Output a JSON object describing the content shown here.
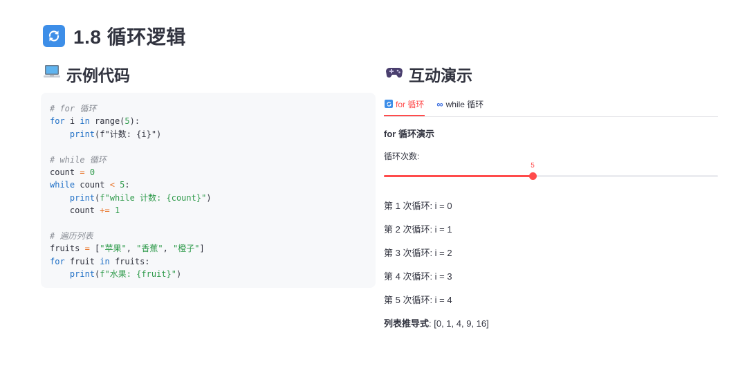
{
  "header": {
    "title": "1.8 循环逻辑",
    "icon": "arrows-cycle-icon"
  },
  "left": {
    "heading": "示例代码",
    "heading_icon": "laptop-icon",
    "code_lines": [
      [
        {
          "t": "# for 循环",
          "c": "cmt"
        }
      ],
      [
        {
          "t": "for",
          "c": "kw"
        },
        {
          "t": " i ",
          "c": "plain"
        },
        {
          "t": "in",
          "c": "kw"
        },
        {
          "t": " range(",
          "c": "plain"
        },
        {
          "t": "5",
          "c": "num"
        },
        {
          "t": "):",
          "c": "plain"
        }
      ],
      [
        {
          "t": "    ",
          "c": "plain"
        },
        {
          "t": "print",
          "c": "fn"
        },
        {
          "t": "(f\"计数: {i}\")",
          "c": "plain"
        }
      ],
      [],
      [
        {
          "t": "# while 循环",
          "c": "cmt"
        }
      ],
      [
        {
          "t": "count ",
          "c": "plain"
        },
        {
          "t": "=",
          "c": "op"
        },
        {
          "t": " ",
          "c": "plain"
        },
        {
          "t": "0",
          "c": "num"
        }
      ],
      [
        {
          "t": "while",
          "c": "kw"
        },
        {
          "t": " count ",
          "c": "plain"
        },
        {
          "t": "<",
          "c": "op"
        },
        {
          "t": " ",
          "c": "plain"
        },
        {
          "t": "5",
          "c": "num"
        },
        {
          "t": ":",
          "c": "plain"
        }
      ],
      [
        {
          "t": "    ",
          "c": "plain"
        },
        {
          "t": "print",
          "c": "fn"
        },
        {
          "t": "(",
          "c": "plain"
        },
        {
          "t": "f\"while 计数: {count}\"",
          "c": "str"
        },
        {
          "t": ")",
          "c": "plain"
        }
      ],
      [
        {
          "t": "    count ",
          "c": "plain"
        },
        {
          "t": "+=",
          "c": "op"
        },
        {
          "t": " ",
          "c": "plain"
        },
        {
          "t": "1",
          "c": "num"
        }
      ],
      [],
      [
        {
          "t": "# 遍历列表",
          "c": "cmt"
        }
      ],
      [
        {
          "t": "fruits ",
          "c": "plain"
        },
        {
          "t": "=",
          "c": "op"
        },
        {
          "t": " [",
          "c": "plain"
        },
        {
          "t": "\"苹果\"",
          "c": "str"
        },
        {
          "t": ", ",
          "c": "plain"
        },
        {
          "t": "\"香蕉\"",
          "c": "str"
        },
        {
          "t": ", ",
          "c": "plain"
        },
        {
          "t": "\"橙子\"",
          "c": "str"
        },
        {
          "t": "]",
          "c": "plain"
        }
      ],
      [
        {
          "t": "for",
          "c": "kw"
        },
        {
          "t": " fruit ",
          "c": "plain"
        },
        {
          "t": "in",
          "c": "kw"
        },
        {
          "t": " fruits:",
          "c": "plain"
        }
      ],
      [
        {
          "t": "    ",
          "c": "plain"
        },
        {
          "t": "print",
          "c": "fn"
        },
        {
          "t": "(",
          "c": "plain"
        },
        {
          "t": "f\"水果: {fruit}\"",
          "c": "str"
        },
        {
          "t": ")",
          "c": "plain"
        }
      ]
    ]
  },
  "right": {
    "heading": "互动演示",
    "heading_icon": "gamepad-icon",
    "tabs": [
      {
        "label": "for 循环",
        "icon": "arrows-cycle-icon",
        "active": true
      },
      {
        "label": "while 循环",
        "icon": "infinity-icon",
        "active": false
      }
    ],
    "section_title": "for 循环演示",
    "slider": {
      "label": "循环次数:",
      "value": "5",
      "fraction": 0.445
    },
    "loop_results": [
      "第 1 次循环: i = 0",
      "第 2 次循环: i = 1",
      "第 3 次循环: i = 2",
      "第 4 次循环: i = 3",
      "第 5 次循环: i = 4"
    ],
    "list_comp": {
      "label": "列表推导式",
      "value": ": [0, 1, 4, 9, 16]"
    }
  },
  "colors": {
    "accent": "#ff4b4b",
    "text": "#31333f",
    "code_bg": "#f7f8fa"
  }
}
